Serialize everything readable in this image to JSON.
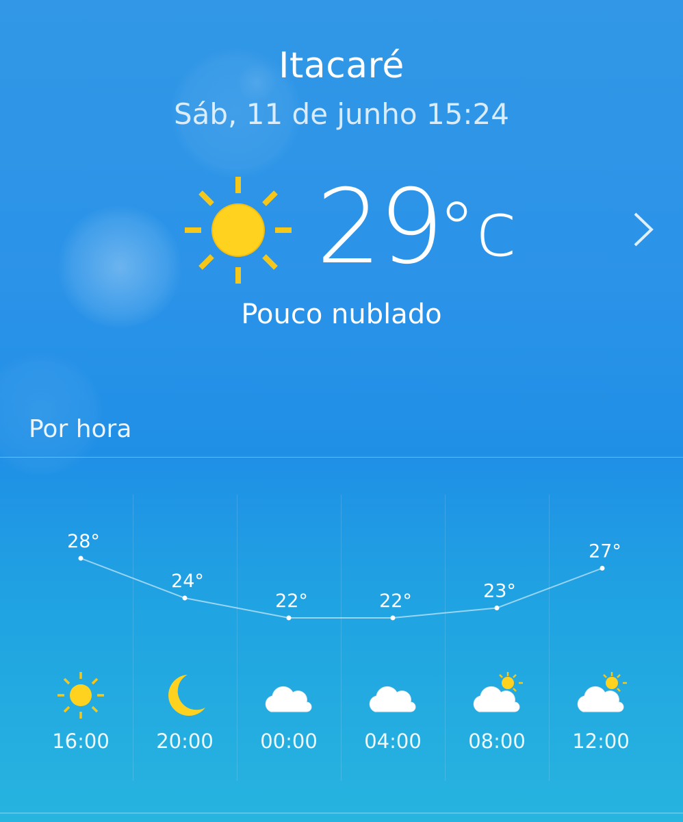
{
  "location": {
    "city": "Itacaré",
    "datetime": "Sáb, 11 de junho 15:24"
  },
  "current": {
    "icon": "sun-icon",
    "temperature": "29",
    "unit": "°c",
    "condition": "Pouco nublado"
  },
  "hourly": {
    "section_title": "Por hora",
    "chart_data": {
      "type": "line",
      "x": [
        "16:00",
        "20:00",
        "00:00",
        "04:00",
        "08:00",
        "12:00"
      ],
      "series": [
        {
          "values": [
            28,
            24,
            22,
            22,
            23,
            27
          ]
        }
      ],
      "labels": [
        "28°",
        "24°",
        "22°",
        "22°",
        "23°",
        "27°"
      ]
    },
    "items": [
      {
        "time": "16:00",
        "temp": "28°",
        "icon": "sun-icon"
      },
      {
        "time": "20:00",
        "temp": "24°",
        "icon": "moon-icon"
      },
      {
        "time": "00:00",
        "temp": "22°",
        "icon": "partly-cloudy-night-icon"
      },
      {
        "time": "04:00",
        "temp": "22°",
        "icon": "partly-cloudy-night-icon"
      },
      {
        "time": "08:00",
        "temp": "23°",
        "icon": "partly-cloudy-day-icon"
      },
      {
        "time": "12:00",
        "temp": "27°",
        "icon": "partly-cloudy-day-icon"
      }
    ]
  },
  "colors": {
    "sun": "#ffd21f",
    "sun_rays": "#f6c71b",
    "background_top": "#3197e6",
    "background_bottom": "#27b4df"
  }
}
